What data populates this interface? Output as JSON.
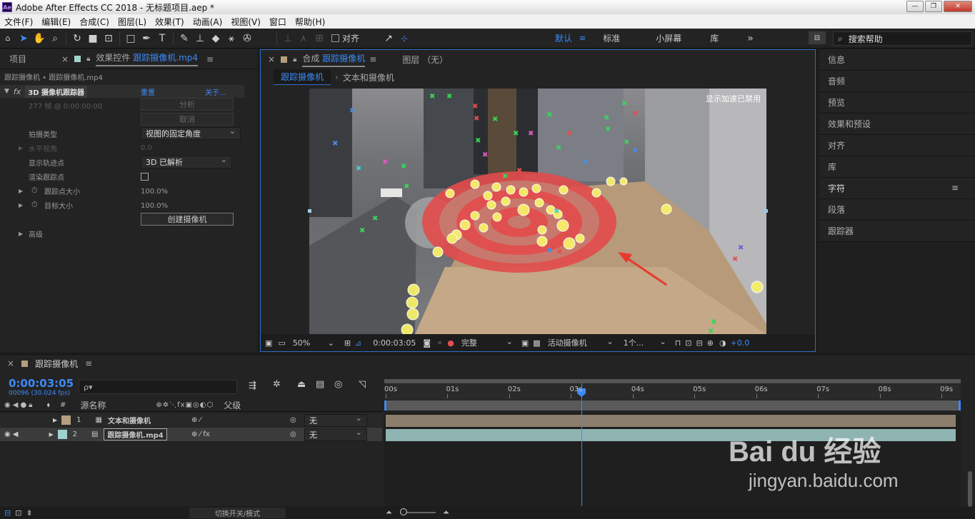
{
  "app": {
    "title": "Adobe After Effects CC 2018 - 无标题项目.aep *",
    "logo": "Ae",
    "window_controls": {
      "minimize": "—",
      "restore": "❐",
      "close": "✕"
    }
  },
  "menu": [
    "文件(F)",
    "编辑(E)",
    "合成(C)",
    "图层(L)",
    "效果(T)",
    "动画(A)",
    "视图(V)",
    "窗口",
    "帮助(H)"
  ],
  "toolbar": {
    "snap_label": "对齐",
    "workspaces": [
      "默认",
      "标准",
      "小屏幕",
      "库"
    ],
    "more": "»",
    "search_placeholder": "搜索帮助"
  },
  "left_panel": {
    "tab_project": "项目",
    "tab_effects_prefix": "效果控件",
    "tab_effects_file": "跟踪摄像机.mp4",
    "breadcrumb": "跟踪摄像机 • 跟踪摄像机.mp4",
    "effect_name": "3D 摄像机跟踪器",
    "reset": "重置",
    "about": "关于...",
    "frame_info": "277 帧 @ 0:00:00:00",
    "analyze": "分析",
    "cancel": "取消",
    "shot_type_label": "拍摄类型",
    "shot_type_value": "视图的固定角度",
    "hfov_label": "水平视角",
    "hfov_value": "0.0",
    "show_track_label": "显示轨迹点",
    "show_track_value": "3D 已解析",
    "render_track_label": "渲染跟踪点",
    "track_size_label": "跟踪点大小",
    "track_size_value": "100.0%",
    "target_size_label": "目标大小",
    "target_size_value": "100.0%",
    "create_camera": "创建摄像机",
    "advanced": "高级"
  },
  "comp_panel": {
    "tab_prefix": "合成",
    "tab_name": "跟踪摄像机",
    "layer_tab": "图层 （无）",
    "crumb_active": "跟踪摄像机",
    "crumb_next": "文本和摄像机",
    "accel_notice": "显示加速已禁用",
    "zoom": "50%",
    "timecode": "0:00:03:05",
    "quality": "完整",
    "camera": "活动摄像机",
    "views": "1个...",
    "exposure": "+0.0"
  },
  "right_panel": [
    "信息",
    "音频",
    "预览",
    "效果和预设",
    "对齐",
    "库",
    "字符",
    "段落",
    "跟踪器"
  ],
  "timeline": {
    "tab": "跟踪摄像机",
    "timecode": "0:00:03:05",
    "fps": "00096 (30.024 fps)",
    "search_placeholder": "ρ▾",
    "col_num": "#",
    "col_source": "源名称",
    "col_parent": "父级",
    "ruler": [
      "00s",
      "01s",
      "02s",
      "03s",
      "04s",
      "05s",
      "06s",
      "07s",
      "08s",
      "09s"
    ],
    "playhead_seconds": 3.17,
    "duration_seconds": 9.23,
    "layers": [
      {
        "num": "1",
        "name": "文本和摄像机",
        "color": "#b59e7e",
        "parent": "无"
      },
      {
        "num": "2",
        "name": "跟踪摄像机.mp4",
        "color": "#9fd2cf",
        "parent": "无"
      }
    ],
    "toggle_label": "切换开关/模式"
  },
  "watermark": {
    "brand": "Bai du 经验",
    "url": "jingyan.baidu.com"
  }
}
